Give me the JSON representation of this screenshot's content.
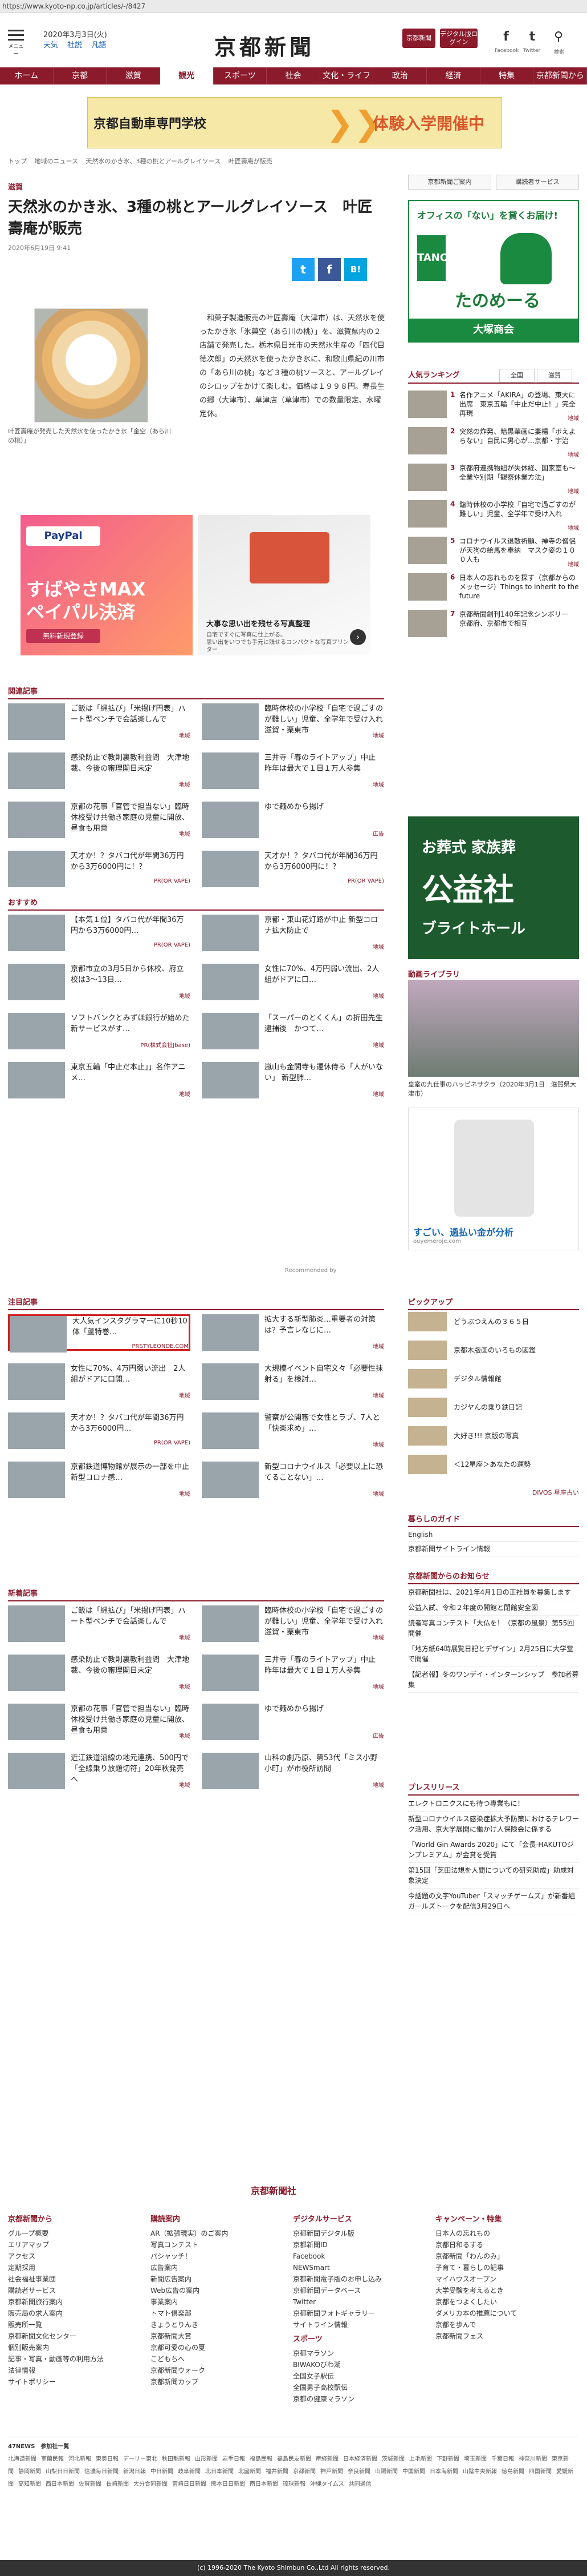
{
  "url": "https://www.kyoto-np.co.jp/articles/-/8427",
  "header": {
    "menu_label": "メニュー",
    "date": "2020年3月3日(火)",
    "weather": [
      "天気",
      "社説",
      "凡語"
    ],
    "logo": "京都新聞",
    "btn_mylist": "京都新聞",
    "btn_digital": "デジタル版ログイン",
    "fb_label": "Facebook",
    "tw_label": "Twitter",
    "search_label": "検索"
  },
  "nav": [
    "ホーム",
    "京都",
    "滋賀",
    "観光",
    "スポーツ",
    "社会",
    "文化・ライフ",
    "政治",
    "経済",
    "特集",
    "京都新聞から"
  ],
  "top_banner": {
    "left": "京都自動車専門学校",
    "right": "体験入学開催中"
  },
  "breadcrumb": [
    "トップ",
    "地域のニュース",
    "天然氷のかき氷、3種の桃とアールグレイソース",
    "叶匠壽庵が販売"
  ],
  "top_buttons": [
    "京都新聞ご案内",
    "購読者サービス"
  ],
  "article": {
    "category": "滋賀",
    "title": "天然氷のかき氷、3種の桃とアールグレイソース　叶匠壽庵が販売",
    "date": "2020年6月19日 9:41",
    "photo_caption": "叶匠壽庵が発売した天然氷を使ったかき氷「金空（あら川の桃）」",
    "body": "和菓子製造販売の叶匠壽庵（大津市）は、天然氷を使ったかき氷「氷菓空（あら川の桃）」を、滋賀県内の２店舗で発売した。栃木県日光市の天然氷生産の「四代目徳次郎」の天然氷を使ったかき氷に、和歌山県紀の川市の「あら川の桃」など３種の桃ソースと、アールグレイのシロップをかけて楽しむ。価格は１９９８円。寿長生の郷（大津市）、草津店（草津市）での数量限定、水曜定休。"
  },
  "ads": {
    "paypal": "PayPal",
    "paypal_big": "すばやさMAX\nペイパル決済",
    "paypal_btn": "無料新規登録",
    "ad2_title": "大事な思い出を残せる写真整理",
    "ad2_sub": "自宅ですぐに写真に仕上がる。\n思い出をいつでも手元に残せるコンパクトな写真プリンター"
  },
  "related": {
    "title": "関連記事",
    "cards": [
      {
        "text": "ご飯は「縄拡び」「米揚げ円表」ハート型ベンチで会話楽しんで",
        "tag": "地域"
      },
      {
        "text": "臨時休校の小学校「自宅で過ごすのが難しい」児童、全学年で受け入れ 滋賀・栗東市",
        "tag": "地域"
      },
      {
        "text": "感染防止で教則裏教利益問　大津地裁、今後の審理開日未定",
        "tag": "地域"
      },
      {
        "text": "三井寺「春のライトアップ」中止　昨年は最大で１日１万人参集",
        "tag": "地域"
      },
      {
        "text": "京都の花事「官管で担当ない」臨時休校受け共働き家庭の児童に開放、昼食も用意",
        "tag": "地域"
      },
      {
        "text": "ゆで麺めから揚げ",
        "tag": "広告"
      },
      {
        "text": "天才か！？タバコ代が年間36万円から3万6000円に！？",
        "tag": "PR(OR VAPE)"
      },
      {
        "text": "天才か！？タバコ代が年間36万円から3万6000円に！？",
        "tag": "PR(OR VAPE)"
      }
    ]
  },
  "osusume": {
    "title": "おすすめ",
    "cards": [
      {
        "text": "【本気１位】タバコ代が年間36万円から3万6000円…",
        "tag": "PR(OR VAPE)"
      },
      {
        "text": "京都・東山花灯路が中止 新型コロナ拡大防止で",
        "tag": "地域"
      },
      {
        "text": "京都市立の3月5日から休校、府立校は3～13日…",
        "tag": "地域"
      },
      {
        "text": "女性に70%、4万円弱い流出、2人組がドアに口…",
        "tag": "地域"
      },
      {
        "text": "ソフトバンクとみずほ銀行が始めた新サービスがす…",
        "tag": "PR(株式会社Jbase)"
      },
      {
        "text": "「スーパーのとくくん」の折田先生逮捕後　かつて…",
        "tag": "地域"
      },
      {
        "text": "東京五輪「中止だ本止」」名作アニメ…",
        "tag": "地域"
      },
      {
        "text": "嵐山も金閣寺も運休侍る「人がいない」 新型肺…",
        "tag": "地域"
      }
    ],
    "recommended": "Recommended by"
  },
  "chumoku": {
    "title": "注目記事",
    "cards": [
      {
        "text": "大人気インスタグラマーに10秒10体「蘆特巻…",
        "tag": "PRSTYLEONDE.COM"
      },
      {
        "text": "拡大する新型肺炎…重要者の対策は？予言レなじに…",
        "tag": "地域"
      },
      {
        "text": "女性に70%、4万円弱い流出　2人組がドアに口開…",
        "tag": "地域"
      },
      {
        "text": "大規模イベント自宅文々「必要性抹射る」を検討…",
        "tag": "地域"
      },
      {
        "text": "天才か！？タバコ代が年間36万円から3万6000円…",
        "tag": "PR(OR VAPE)"
      },
      {
        "text": "警察が公開審で女性とラブ、7人と「快楽求め」…",
        "tag": "地域"
      },
      {
        "text": "京都鉄道博物館が展示の一部を中止 新型コロナ感…",
        "tag": "地域"
      },
      {
        "text": "新型コロナウイルス「必要以上に恐てることない」…",
        "tag": "地域"
      }
    ]
  },
  "shinchaku": {
    "title": "新着記事",
    "cards": [
      {
        "text": "ご飯は「縄拡び」「米揚げ円表」ハート型ベンチで会話楽しんで",
        "tag": "地域"
      },
      {
        "text": "臨時休校の小学校「自宅で過ごすのが難しい」児童、全学年で受け入れ 滋賀・栗東市",
        "tag": "地域"
      },
      {
        "text": "感染防止で教則裏教利益問　大津地裁、今後の審理開日未定",
        "tag": "地域"
      },
      {
        "text": "三井寺「春のライトアップ」中止　昨年は最大で１日１万人参集",
        "tag": "地域"
      },
      {
        "text": "京都の花事「官管で担当ない」臨時休校受け共働き家庭の児童に開放、昼食も用意",
        "tag": "地域"
      },
      {
        "text": "ゆで麺めから揚げ",
        "tag": "広告"
      },
      {
        "text": "近江鉄道沿線の地元連携、500円で「全線乗り放題切符」20年秋発売へ",
        "tag": "地域"
      },
      {
        "text": "山科の劇乃原、第53代「ミス小野小町」が市役所訪問",
        "tag": "地域"
      }
    ]
  },
  "sidebar": {
    "ad1_top": "オフィスの「ない」を貸くお届け!",
    "ad1_logo": "TANO",
    "ad1_brand": "たのめーる",
    "ad1_bar": "大塚商会",
    "ranking_title": "人気ランキング",
    "ranking_tabs": [
      "全国",
      "滋賀"
    ],
    "ranking": [
      {
        "n": "1",
        "text": "名作アニメ「AKIRA」の登場、東大に出席　東京五輪「中止だ中止！」完全再現",
        "tag": "地域"
      },
      {
        "n": "2",
        "text": "突然の炸発、暗黒華画に妻楊「ボえよらない」自民に男心が…京都・宇治",
        "tag": "地域"
      },
      {
        "n": "3",
        "text": "京都府連携物組が失休経、国家室も～全業や別期「観察休業方法」",
        "tag": "地域"
      },
      {
        "n": "4",
        "text": "臨時休校の小学校「自宅で過ごすのが難しい」児童、全学年で受け入れ",
        "tag": "地域"
      },
      {
        "n": "5",
        "text": "コロナウイルス退散祈願、禅寺の僧侶が天狗の絵馬を奉納　マスク姿の１００人も",
        "tag": "地域"
      },
      {
        "n": "6",
        "text": "日本人の忘れものを探す（京都からのメッセージ）Things to inherit to the future",
        "tag": ""
      },
      {
        "n": "7",
        "text": "京都新聞創刊140年記念シンボリー　京都府、京都市で相互",
        "tag": ""
      }
    ],
    "ad2_a": "お葬式 家族葬",
    "ad2_b": "公益社",
    "ad2_c": "ブライトホール",
    "video_title": "動画ライブラリ",
    "video_caption": "皇室の九仕事のハッピネサクラ（2020年3月1日　滋賀県大津市）",
    "ad3_big": "すごい、過払い金が分析",
    "ad3_sm": "ouyemeroje.com",
    "pickup_title": "ピックアップ",
    "pickup": [
      "どうぶつえんの３６５日",
      "京都木版画のいろもの図鑑",
      "デジタル情報館",
      "カジヤんの乗り鉄日記",
      "大好き!!! 京版の写真",
      "＜12星座＞あなたの運勢"
    ],
    "pickup_more": "DIVOS 星座占い",
    "guide_title": "暮らしのガイド",
    "guide": [
      "English",
      "京都新聞サイトライン情報"
    ],
    "notice_title": "京都新聞からのお知らせ",
    "notice": [
      "京都新聞社は、2021年4月1日の正社員を募集します",
      "公益入試、令和２年度の開館と閉館安全図",
      "読者写真コンテスト「大仏を！（京都の風景）第55回開催",
      "「地方紙64時展覧日記とデザイン」2月25日に大学堂で開催",
      "【記者報】冬のワンデイ・インターンシップ　参加者募集"
    ],
    "press_title": "プレスリリース",
    "press": [
      "エレクトロニクスにも待つ専業もに！",
      "新型コロナウイルス感染症拡大予防策におけるテレワーク活用、京大学展開に働かけ人保険会に係する",
      "「World Gin Awards 2020」にて「会長-HAKUTOジンプレミアム」が金賞を受賞",
      "第15回「芝田法規を人間についての研究助成」助成対象決定",
      "今話題の文字YouTuber「スマッチゲームズ」が新番組ガールズトークを配信3月29日へ"
    ]
  },
  "footer": {
    "logo": "京都新聞社",
    "cols": [
      {
        "head": "京都新聞から",
        "items": [
          "グループ概要",
          "エリアマップ",
          "アクセス",
          "定期採用",
          "社会福祉事業団",
          "購読者サービス",
          "京都新聞旅行案内",
          "販売局の求人案内",
          "販売所一覧",
          "京都新聞文化センター",
          "個別販売案内",
          "記事・写真・動画等の利用方法",
          "法律情報",
          "サイトポリシー"
        ]
      },
      {
        "head": "購読案内",
        "items": [
          "AR（拡張現実）のご案内",
          "写真コンテスト",
          "パシャッチ！",
          "広告案内",
          "新聞広告案内",
          "Web広告の案内",
          "事業案内",
          "トマト倶楽部",
          "きょうとりんき",
          "京都新聞大賞",
          "京都可愛の心の夏",
          "こどもちへ",
          "京都新聞ウォーク",
          "京都新聞カップ"
        ]
      },
      {
        "head": "デジタルサービス",
        "items": [
          "京都新聞デジタル版",
          "京都新聞ID",
          "Facebook",
          "NEWSmart",
          "京都新聞電子版のお申し込み",
          "京都新聞データベース",
          "Twitter",
          "京都新聞フォトギャラリー",
          "サイトライン情報"
        ]
      },
      {
        "head": "キャンペーン・特集",
        "items": [
          "日本人の忘れもの",
          "京都日和るする",
          "京都新聞「わんのみ」",
          "子育て・暮らしの記事",
          "マイハウスオープン",
          "大学受験を考えるとき",
          "京都をつよくしたい",
          "ダメリカ本の推薦について",
          "京都を歩んで",
          "京都新聞フェス"
        ]
      }
    ],
    "sports_head": "スポーツ",
    "sports_items": [
      "京都マラソン",
      "BIWAKOびわ湖",
      "全国女子駅伝",
      "全国男子高校駅伝",
      "京都の健康マラソン"
    ],
    "news_head": "47NEWS　参加社一覧",
    "news": [
      "北海道新聞",
      "室蘭民報",
      "河北新報",
      "東奥日報",
      "デーリー東北",
      "秋田魁新報",
      "山形新聞",
      "岩手日報",
      "福島民報",
      "福島民友新聞",
      "産経新聞",
      "日本経済新聞",
      "茨城新聞",
      "上毛新聞",
      "下野新聞",
      "埼玉新聞",
      "千葉日報",
      "神奈川新聞",
      "東京新聞",
      "静岡新聞",
      "山梨日日新聞",
      "信濃毎日新聞",
      "新潟日報",
      "中日新聞",
      "岐阜新聞",
      "北日本新聞",
      "北國新聞",
      "福井新聞",
      "京都新聞",
      "神戸新聞",
      "奈良新聞",
      "山陽新聞",
      "中国新聞",
      "日本海新聞",
      "山陰中央新報",
      "徳島新聞",
      "四国新聞",
      "愛媛新聞",
      "高知新聞",
      "西日本新聞",
      "佐賀新聞",
      "長崎新聞",
      "大分合同新聞",
      "宮崎日日新聞",
      "熊本日日新聞",
      "南日本新聞",
      "琉球新報",
      "沖縄タイムス",
      "共同通信"
    ],
    "copyright": "(c) 1996-2020 The Kyoto Shimbun Co.,Ltd All rights reserved."
  }
}
